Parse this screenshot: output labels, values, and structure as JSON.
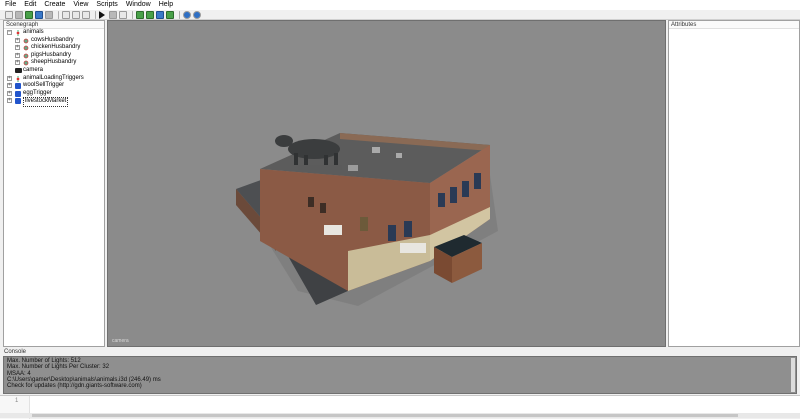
{
  "menu": [
    "File",
    "Edit",
    "Create",
    "View",
    "Scripts",
    "Window",
    "Help"
  ],
  "scenegraph": {
    "title": "Scenegraph",
    "nodes": [
      {
        "label": "animals",
        "depth": 0,
        "icon": "transform-icon",
        "expander": "−"
      },
      {
        "label": "cowsHusbandry",
        "depth": 1,
        "icon": "husbandry-icon",
        "expander": "+"
      },
      {
        "label": "chickenHusbandry",
        "depth": 1,
        "icon": "husbandry-icon",
        "expander": "+"
      },
      {
        "label": "pigsHusbandry",
        "depth": 1,
        "icon": "husbandry-icon",
        "expander": "+"
      },
      {
        "label": "sheepHusbandry",
        "depth": 1,
        "icon": "husbandry-icon",
        "expander": "+"
      },
      {
        "label": "camera",
        "depth": 0,
        "icon": "camera-icon",
        "expander": ""
      },
      {
        "label": "animalLoadingTriggers",
        "depth": 0,
        "icon": "transform-icon",
        "expander": "+"
      },
      {
        "label": "woolSellTrigger",
        "depth": 0,
        "icon": "trigger-icon",
        "expander": "+"
      },
      {
        "label": "eggTrigger",
        "depth": 0,
        "icon": "trigger-icon",
        "expander": "+"
      },
      {
        "label": "livestockMarket",
        "depth": 0,
        "icon": "trigger-icon",
        "expander": "+",
        "selected": true
      }
    ]
  },
  "viewport": {
    "camera_label": "camera"
  },
  "attributes": {
    "title": "Attributes"
  },
  "console": {
    "title": "Console",
    "lines": [
      "Max. Number of Lights: 512",
      "Max. Number of Lights Per Cluster: 32",
      "MSAA: 4",
      "C:\\Users\\gamer\\Desktop\\animals\\animals.i3d (246.49) ms",
      "Check for updates (http://gdn.giants-software.com)"
    ]
  },
  "script_editor": {
    "line_number": "1"
  },
  "colors": {
    "viewport_bg": "#8b8b8b",
    "console_bg": "#8f8f8f",
    "trigger_blue": "#2255cc"
  }
}
